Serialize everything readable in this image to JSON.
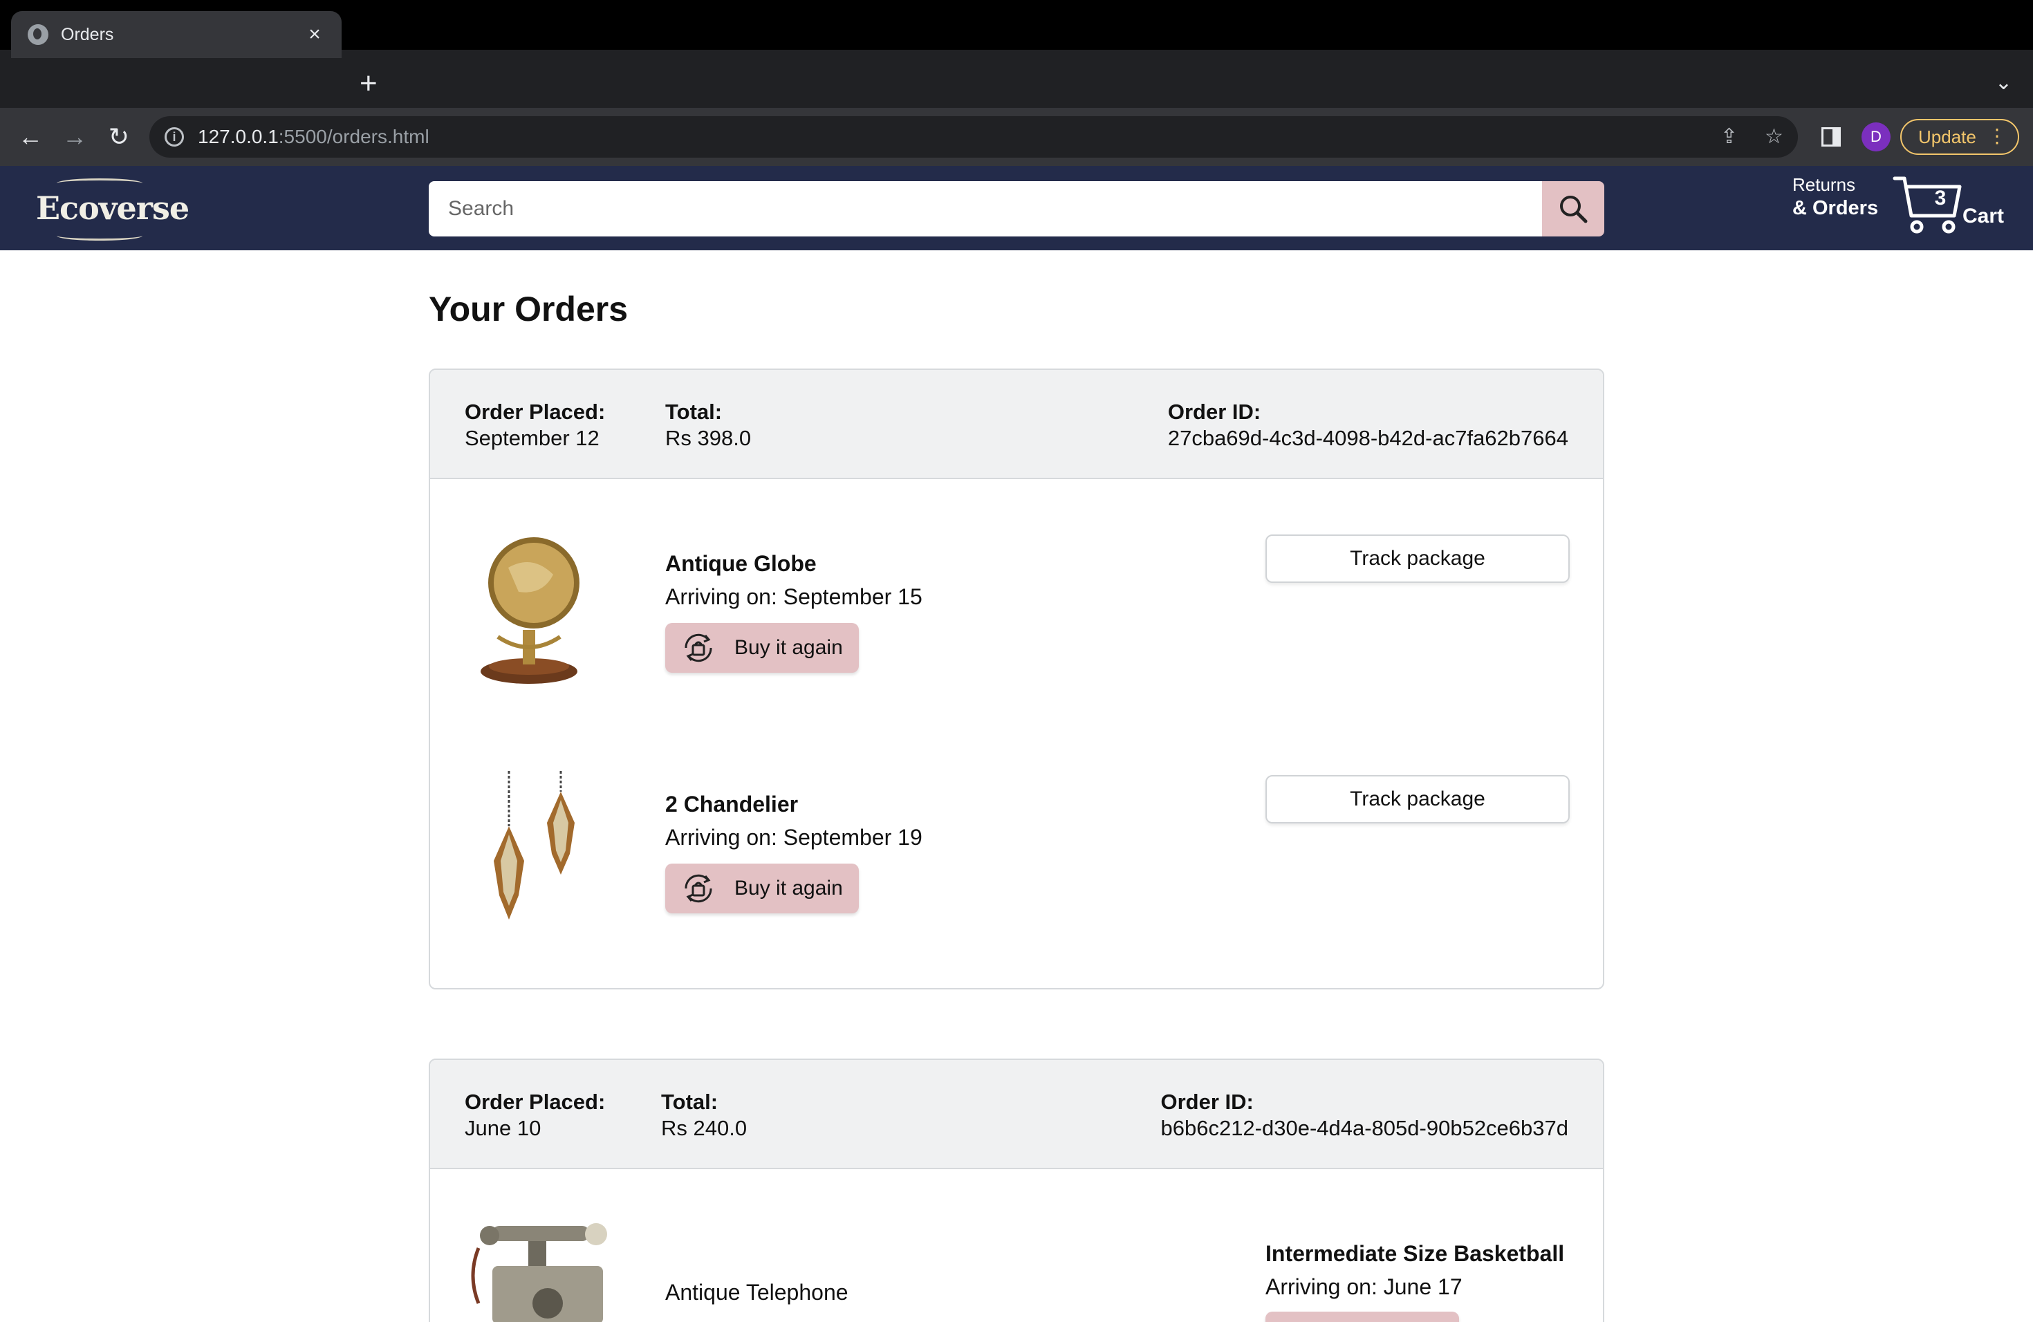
{
  "browser": {
    "tab_title": "Orders",
    "new_tab": "+",
    "url_host": "127.0.0.1",
    "url_path": ":5500/orders.html",
    "profile_initial": "D",
    "update_label": "Update"
  },
  "header": {
    "logo_text": "Ecoverse",
    "search_placeholder": "Search",
    "returns_line1": "Returns",
    "returns_line2": "& Orders",
    "cart_count": "3",
    "cart_label": "Cart"
  },
  "page": {
    "title": "Your Orders"
  },
  "orders": [
    {
      "placed_label": "Order Placed:",
      "placed_value": "September 12",
      "total_label": "Total:",
      "total_value": "Rs 398.0",
      "id_label": "Order ID:",
      "id_value": "27cba69d-4c3d-4098-b42d-ac7fa62b7664",
      "items": [
        {
          "name": "Antique Globe",
          "arriving": "Arriving on: September 15",
          "buy_again": "Buy it again",
          "track": "Track package"
        },
        {
          "name": "2 Chandelier",
          "arriving": "Arriving on: September 19",
          "buy_again": "Buy it again",
          "track": "Track package"
        }
      ]
    },
    {
      "placed_label": "Order Placed:",
      "placed_value": "June 10",
      "total_label": "Total:",
      "total_value": "Rs 240.0",
      "id_label": "Order ID:",
      "id_value": "b6b6c212-d30e-4d4a-805d-90b52ce6b37d",
      "items": [
        {
          "name": "Antique Telephone"
        },
        {
          "name": "Intermediate Size Basketball",
          "arriving": "Arriving on: June 17"
        }
      ]
    }
  ],
  "colors": {
    "header_bg": "#232b4a",
    "accent_pink": "#e3c1c4",
    "order_head_bg": "#f0f1f2"
  }
}
